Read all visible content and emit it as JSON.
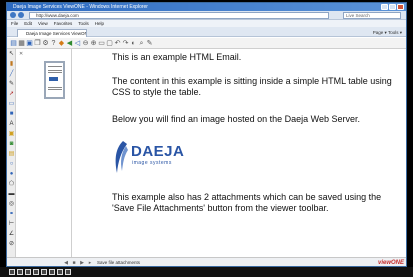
{
  "window": {
    "title": "Daeja Image Services ViewONE - Windows Internet Explorer",
    "address": "http://www.daeja.com",
    "search_placeholder": "Live Search"
  },
  "menu": [
    "File",
    "Edit",
    "View",
    "Favorites",
    "Tools",
    "Help"
  ],
  "tab": {
    "label": "Daeja Image Services ViewONE",
    "tools": "Page ▾  Tools ▾"
  },
  "tooltip": "Save file attachments",
  "content": {
    "p1": "This is an example HTML Email.",
    "p2": "The content in this example is sitting inside a simple HTML table using CSS to style the table.",
    "p3": "Below you will find an image hosted on the Daeja Web Server.",
    "p4": "This example also has 2 attachments which can be saved using the 'Save File Attachments' button from the viewer toolbar.",
    "logo_word": "DAEJA",
    "logo_sub": "image systems"
  },
  "status": {
    "text": "Save file attachments",
    "brand": "viewONE"
  },
  "colors": {
    "titlebar": "#2c6ac1",
    "logo": "#2a55a5",
    "brand": "#c42b2b"
  }
}
